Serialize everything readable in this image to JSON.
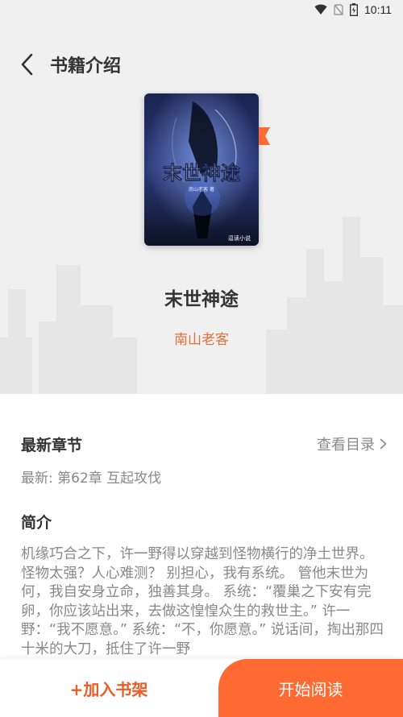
{
  "status_bar": {
    "time": "10:11"
  },
  "header": {
    "title": "书籍介绍",
    "back_icon": "chevron-left-icon"
  },
  "book": {
    "title": "末世神途",
    "author": "南山老客",
    "cover_title": "末世神途",
    "cover_subtitle": "南山老客 著",
    "cover_publisher": "逗读小说"
  },
  "latest_chapter": {
    "heading": "最新章节",
    "catalog_link": "查看目录",
    "text": "最新: 第62章 互起攻伐"
  },
  "intro": {
    "heading": "简介",
    "text": "机缘巧合之下，许一野得以穿越到怪物横行的净土世界。 怪物太强？人心难测？ 别担心，我有系统。 管他末世为何，我自安身立命，独善其身。 系统：“覆巢之下安有完卵，你应该站出来，去做这惶惶众生的救世主。” 许一野：“我不愿意。” 系统：“不，你愿意。” 说话间，掏出那四十米的大刀，抵住了许一野"
  },
  "actions": {
    "add_to_shelf": "+加入书架",
    "start_reading": "开始阅读"
  },
  "colors": {
    "accent": "#ff6a33",
    "author": "#e2703a",
    "hero_bg": "#f0f0f0"
  }
}
